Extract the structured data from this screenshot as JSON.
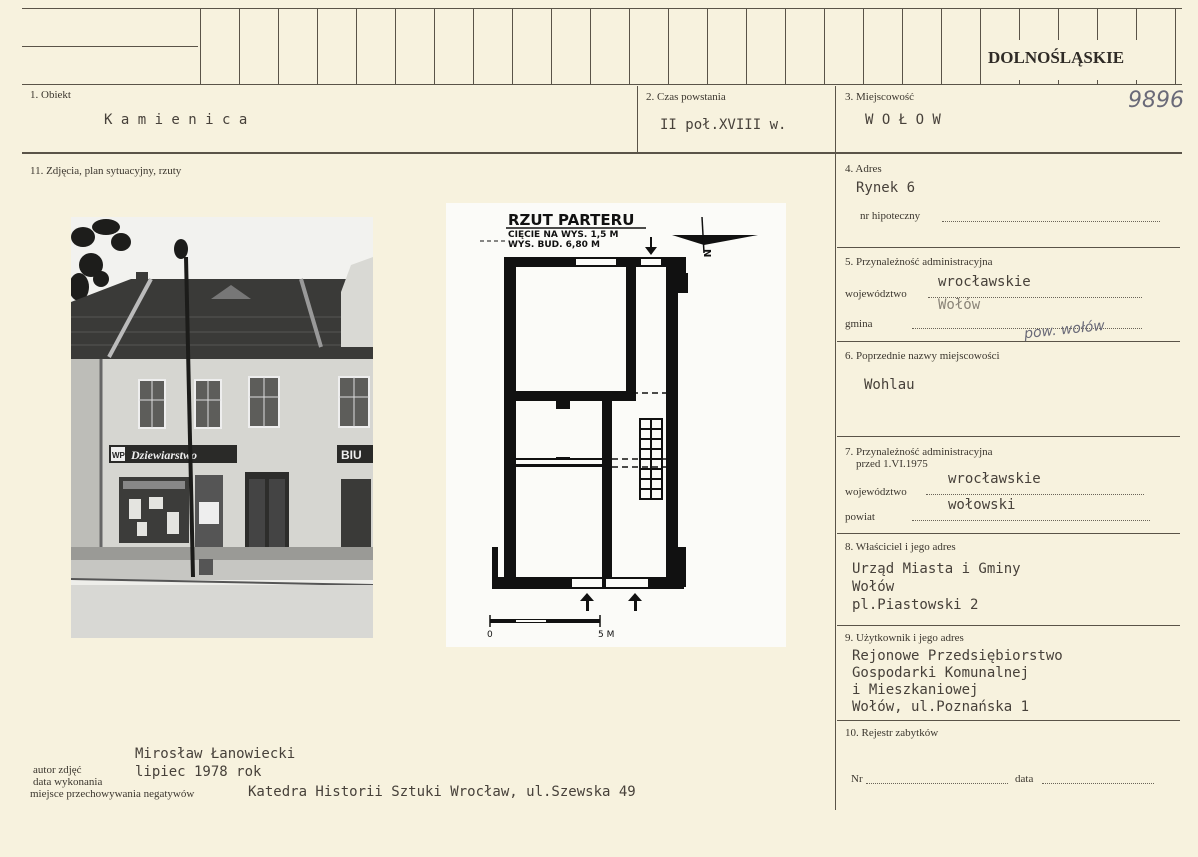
{
  "region_stamp": "DOLNOŚLĄSKIE",
  "catalog_number": "9896",
  "fields": {
    "obiekt": {
      "label": "1. Obiekt",
      "value": "K a m i e n i c a"
    },
    "czas": {
      "label": "2. Czas powstania",
      "value": "II poł.XVIII w."
    },
    "miejscowosc": {
      "label": "3. Miejscowość",
      "value": "W O Ł O W"
    },
    "adres": {
      "label": "4. Adres",
      "value": "Rynek 6",
      "hipoteczny_label": "nr hipoteczny"
    },
    "przynaleznosc": {
      "label": "5. Przynależność administracyjna",
      "woj_label": "województwo",
      "woj_value": "wrocławskie",
      "woj_sub": "Wołów",
      "gmina_label": "gmina",
      "gmina_hand": "pow. wołów"
    },
    "poprzednie": {
      "label": "6. Poprzednie nazwy miejscowości",
      "value": "Wohlau"
    },
    "przynaleznosc_przed": {
      "label_1": "7. Przynależność administracyjna",
      "label_2": "przed 1.VI.1975",
      "woj_label": "województwo",
      "woj_value": "wrocławskie",
      "powiat_label": "powiat",
      "powiat_value": "wołowski"
    },
    "wlasciciel": {
      "label": "8. Właściciel i jego adres",
      "lines": [
        "Urząd Miasta i Gminy",
        "Wołów",
        "pl.Piastowski 2"
      ]
    },
    "uzytkownik": {
      "label": "9. Użytkownik i jego adres",
      "lines": [
        "Rejonowe Przedsiębiorstwo",
        "Gospodarki Komunalnej",
        "i Mieszkaniowej",
        "Wołów, ul.Poznańska 1"
      ]
    },
    "rejestr": {
      "label": "10. Rejestr zabytków",
      "nr_label": "Nr",
      "data_label": "data"
    },
    "zdjecia": {
      "label": "11. Zdjęcia, plan sytuacyjny, rzuty"
    }
  },
  "photo": {
    "shop_sign": "Dziewiarstwo",
    "sign_right": "BIU",
    "sign_small": "WP"
  },
  "plan": {
    "title": "RZUT PARTERU",
    "line2": "CIĘCIE NA WYS. 1,5 M",
    "line3": "WYS. BUD. 6,80 M",
    "north": "N",
    "scale_start": "0",
    "scale_end": "5 M"
  },
  "footer": {
    "autor_label": "autor zdjęć",
    "autor_value": "Mirosław Łanowiecki",
    "data_label": "data wykonania",
    "data_value": "lipiec 1978 rok",
    "miejsce_label": "miejsce przechowywania negatywów",
    "miejsce_value": "Katedra Historii Sztuki  Wrocław, ul.Szewska 49"
  }
}
